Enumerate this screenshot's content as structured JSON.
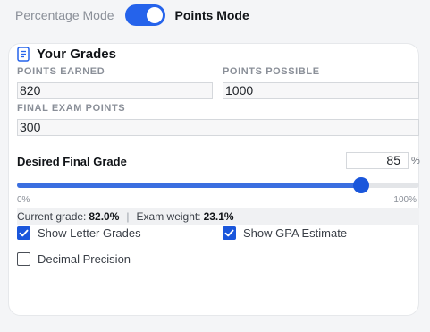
{
  "mode": {
    "percentage_label": "Percentage Mode",
    "points_label": "Points Mode",
    "points_mode_on": true
  },
  "card": {
    "title": "Your Grades",
    "icon": "document-icon"
  },
  "fields": {
    "points_earned": {
      "label": "POINTS EARNED",
      "value": "820"
    },
    "points_possible": {
      "label": "POINTS POSSIBLE",
      "value": "1000"
    },
    "final_exam_points": {
      "label": "FINAL EXAM POINTS",
      "value": "300"
    }
  },
  "desired": {
    "label": "Desired Final Grade",
    "value": "85",
    "unit": "%"
  },
  "slider": {
    "value_percent": 85,
    "min_label": "0%",
    "max_label": "100%"
  },
  "stats": {
    "current_label": "Current grade:",
    "current_value": "82.0%",
    "separator": "|",
    "weight_label": "Exam weight:",
    "weight_value": "23.1%"
  },
  "options": {
    "letter_grades": {
      "label": "Show Letter Grades",
      "checked": true
    },
    "gpa_estimate": {
      "label": "Show GPA Estimate",
      "checked": true
    },
    "decimal_precision": {
      "label": "Decimal Precision",
      "checked": false
    }
  },
  "colors": {
    "accent": "#1a56db",
    "slider_fill": "#3b6fe0"
  }
}
